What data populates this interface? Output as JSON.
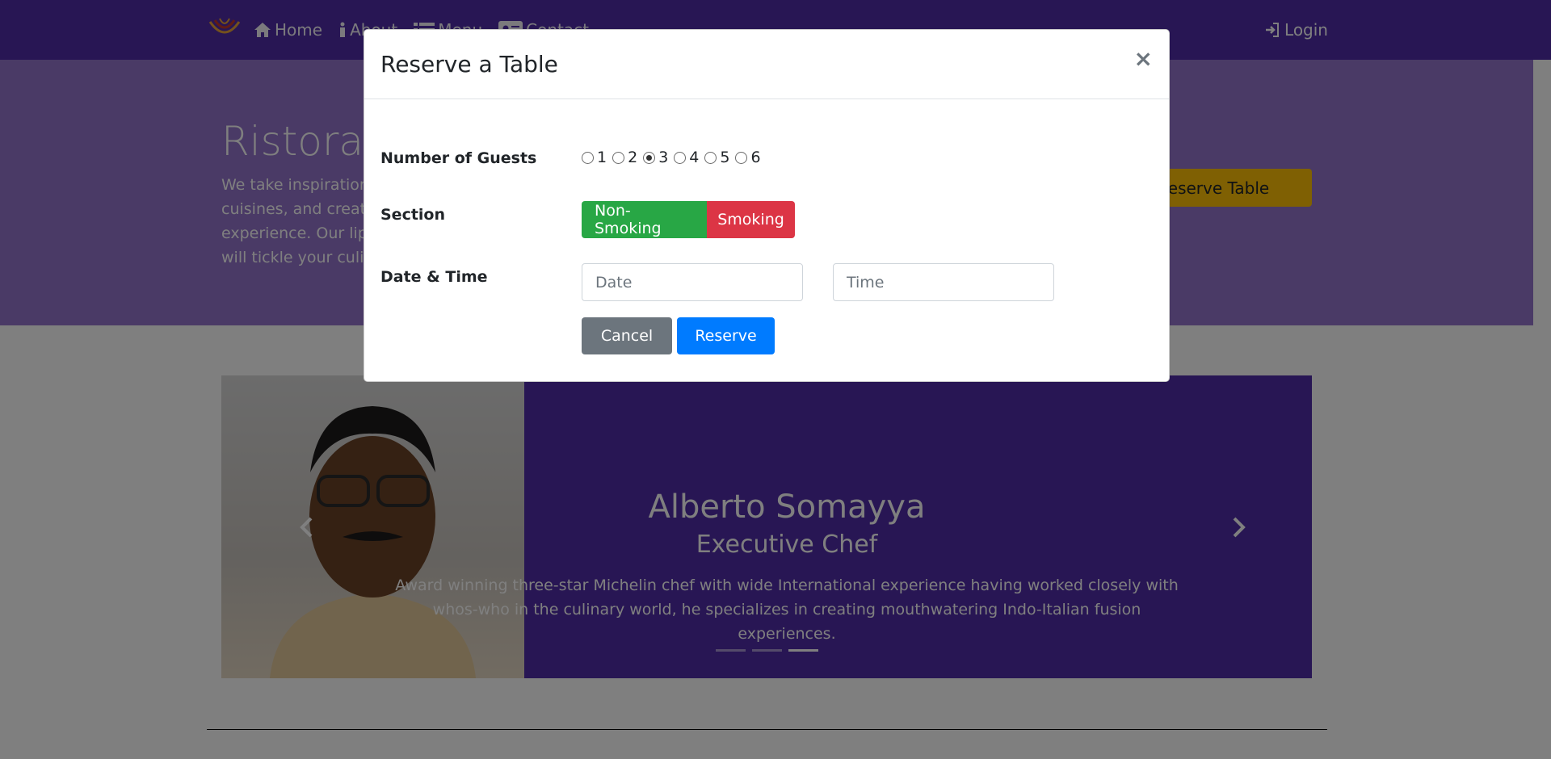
{
  "nav": {
    "links": [
      {
        "label": "Home",
        "icon": "home-icon"
      },
      {
        "label": "About",
        "icon": "info-icon"
      },
      {
        "label": "Menu",
        "icon": "list-icon"
      },
      {
        "label": "Contact",
        "icon": "address-card-icon"
      }
    ],
    "login_label": "Login"
  },
  "jumbotron": {
    "title": "Ristorante con Fusion",
    "text": "We take inspiration from the World's best cuisines, and create a unique fusion experience. Our lipsmacking creations will tickle your culinary senses!",
    "reserve_label": "Reserve Table"
  },
  "carousel": {
    "name": "Alberto Somayya",
    "title": "Executive Chef",
    "bio": "Award winning three-star Michelin chef with wide International experience having worked closely with whos-who in the culinary world, he specializes in creating mouthwatering Indo-Italian fusion experiences.",
    "slides": 3,
    "active_slide": 3
  },
  "modal": {
    "title": "Reserve a Table",
    "close": "×",
    "guests_label": "Number of Guests",
    "guest_options": [
      "1",
      "2",
      "3",
      "4",
      "5",
      "6"
    ],
    "guests_selected": "3",
    "section_label": "Section",
    "section_nonsmoking": "Non-Smoking",
    "section_smoking": "Smoking",
    "datetime_label": "Date & Time",
    "date_placeholder": "Date",
    "time_placeholder": "Time",
    "cancel_label": "Cancel",
    "reserve_label": "Reserve"
  },
  "colors": {
    "primary": "#512da8",
    "jumbotron": "#9575cd",
    "success": "#28a745",
    "danger": "#dc3545",
    "secondary": "#6c757d",
    "blue": "#007bff",
    "warning": "#ffc107"
  }
}
